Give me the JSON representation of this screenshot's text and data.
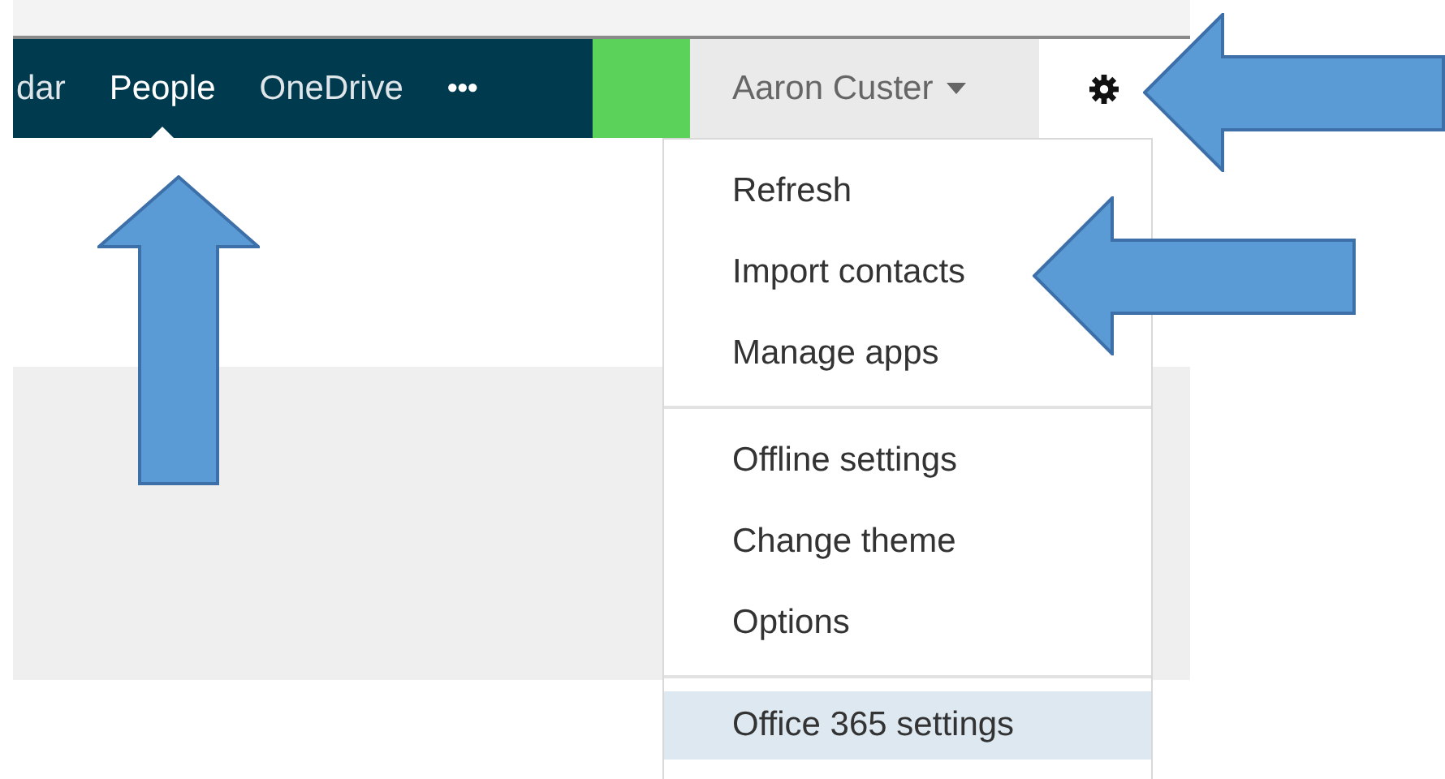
{
  "nav": {
    "tabs": [
      {
        "label": "dar",
        "selected": false
      },
      {
        "label": "People",
        "selected": true
      },
      {
        "label": "OneDrive",
        "selected": false
      }
    ],
    "more": "•••",
    "user": "Aaron Custer"
  },
  "menu": {
    "sections": [
      {
        "items": [
          {
            "label": "Refresh",
            "selected": false
          },
          {
            "label": "Import contacts",
            "selected": false
          },
          {
            "label": "Manage apps",
            "selected": false
          }
        ]
      },
      {
        "items": [
          {
            "label": "Offline settings",
            "selected": false
          },
          {
            "label": "Change theme",
            "selected": false
          },
          {
            "label": "Options",
            "selected": false
          }
        ]
      },
      {
        "items": [
          {
            "label": "Office 365 settings",
            "selected": true
          }
        ]
      }
    ]
  }
}
